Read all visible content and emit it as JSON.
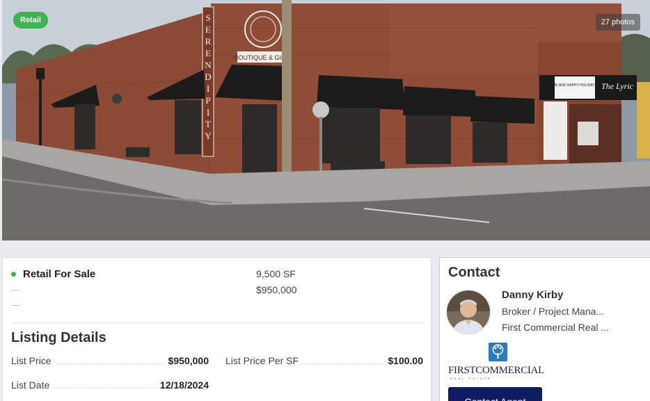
{
  "hero": {
    "badge": "Retail",
    "photos": "27 photos",
    "sign_text": "SERENDIPITY",
    "boutique_text": "BOUTIQUE & GIF",
    "theater_marquee": "WELCOME AND HAPPY HOLIDAYS TO ALL",
    "theater_sign": "The Lyric"
  },
  "summary": {
    "status": "Retail For Sale",
    "dash1": "—",
    "dash2": "—",
    "size": "9,500 SF",
    "price": "$950,000"
  },
  "listing": {
    "title": "Listing Details",
    "list_price_label": "List Price",
    "list_price_value": "$950,000",
    "price_per_sf_label": "List Price Per SF",
    "price_per_sf_value": "$100.00",
    "list_date_label": "List Date",
    "list_date_value": "12/18/2024"
  },
  "contact": {
    "title": "Contact",
    "name": "Danny Kirby",
    "role": "Broker / Project Mana...",
    "company": "First Commercial Real ...",
    "brand_name": "FIRSTCOMMERCIAL",
    "brand_tagline": "REAL ESTATE",
    "button": "Contact Agent"
  },
  "colors": {
    "status_green": "#3fb34f",
    "button_navy": "#0f1c63",
    "brand_blue": "#2a7bc0"
  }
}
